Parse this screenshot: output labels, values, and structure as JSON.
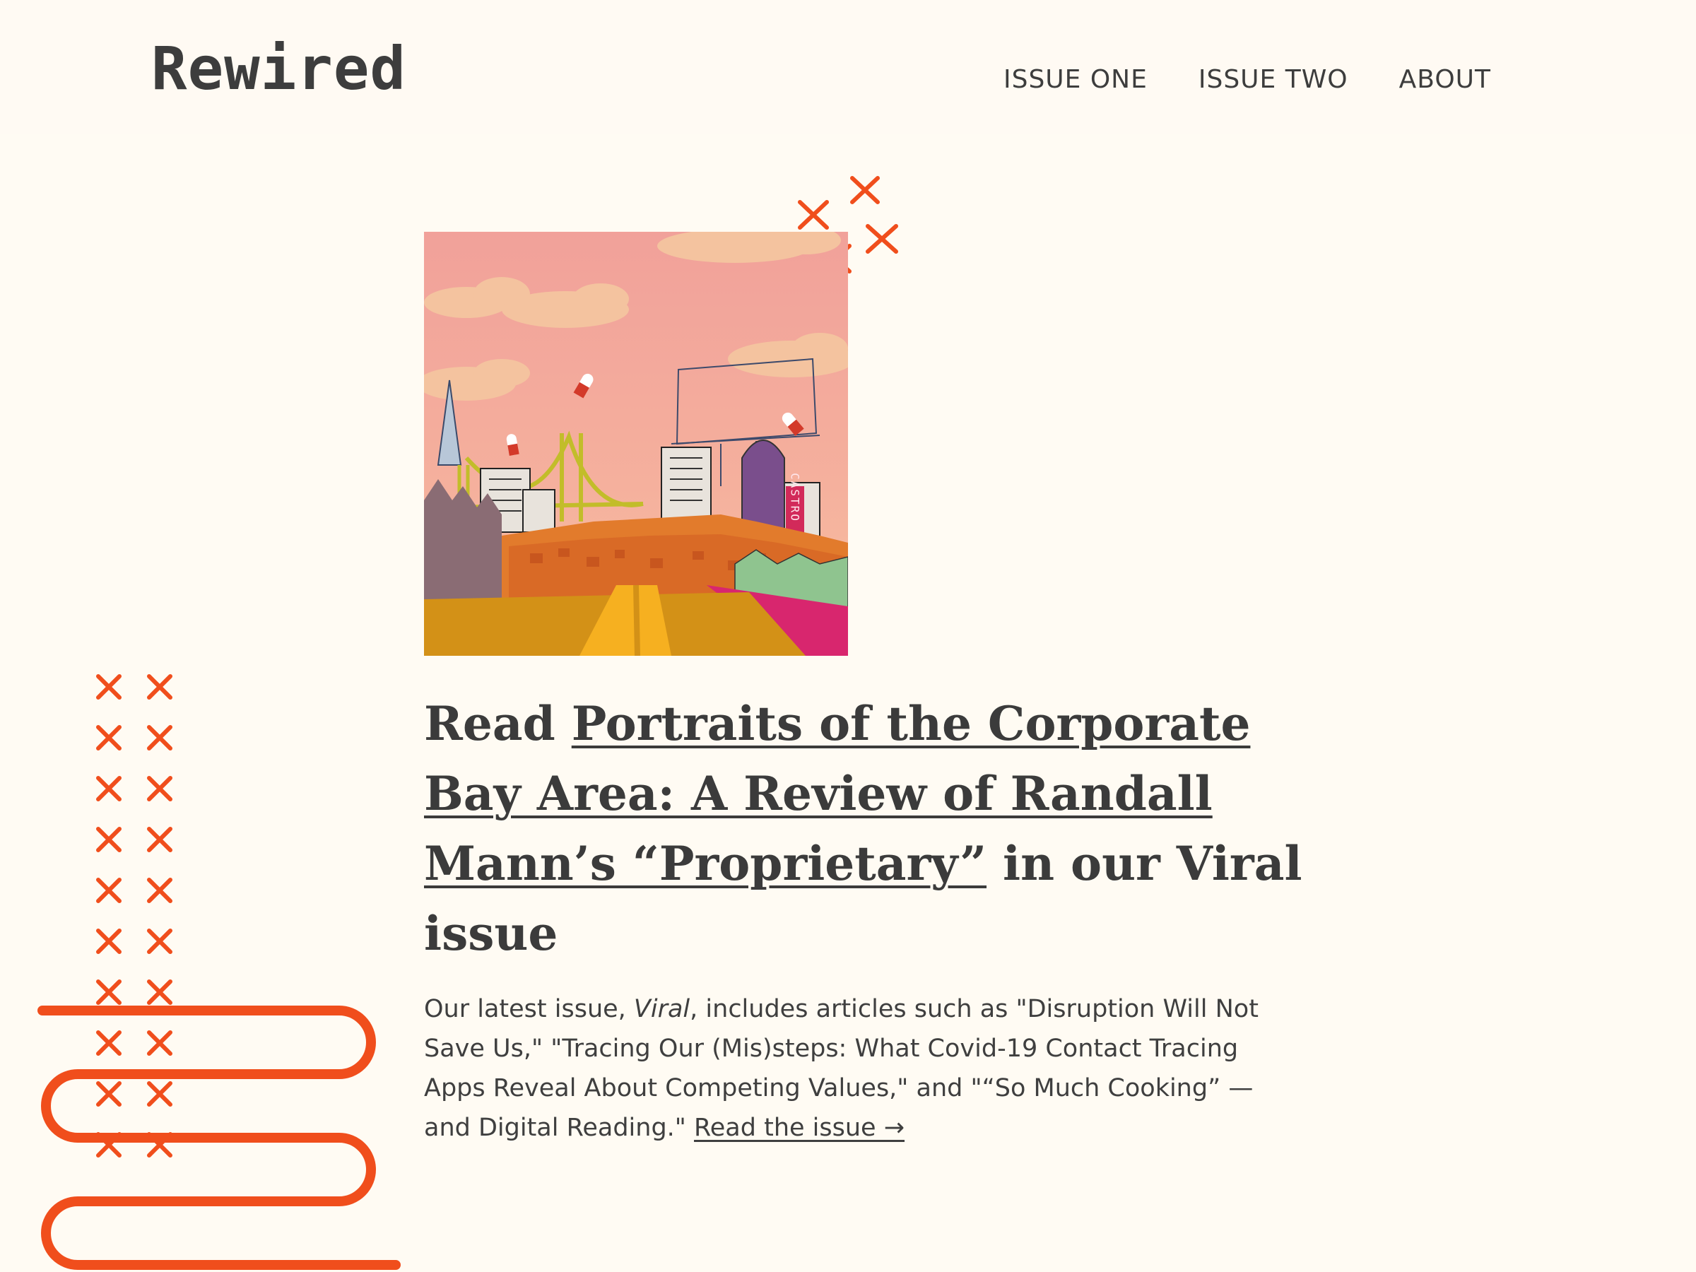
{
  "site": {
    "logo": "Rewired"
  },
  "nav": {
    "items": [
      "ISSUE ONE",
      "ISSUE TWO",
      "ABOUT"
    ]
  },
  "hero_image": {
    "alt": "Illustrated San Francisco skyline with pills falling from a pink sky",
    "sign_text": "CASTRO"
  },
  "headline": {
    "prefix": "Read ",
    "link_text": "Portraits of the Corporate Bay Area: A Review of Randall Mann’s “Proprietary”",
    "suffix": " in our Viral issue"
  },
  "summary": {
    "intro": "Our latest issue, ",
    "issue_name": "Viral",
    "body": ", includes articles such as \"Disruption Will Not Save Us,\" \"Tracing Our (Mis)steps: What Covid-19 Contact Tracing Apps Reveal About Competing Values,\" and \"“So Much Cooking” — and Digital Reading.\" ",
    "link_text": "Read the issue →"
  },
  "colors": {
    "accent": "#f04e1c",
    "background": "#fffbf3",
    "text": "#3b3b3b",
    "sky": "#f3a79c",
    "road": "#f2a51c"
  }
}
